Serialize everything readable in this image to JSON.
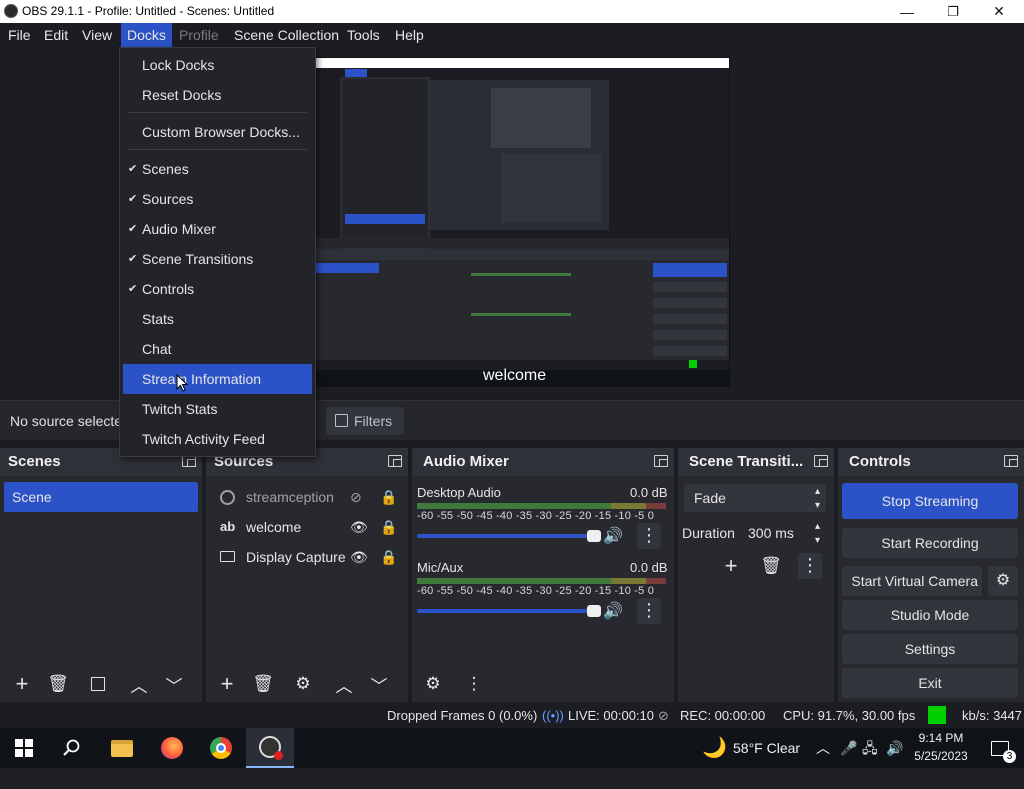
{
  "window": {
    "title": "OBS 29.1.1 - Profile: Untitled - Scenes: Untitled",
    "minimize": "—",
    "maximize": "❐",
    "close": "✕"
  },
  "menubar": {
    "items": [
      "File",
      "Edit",
      "View",
      "Docks",
      "Profile",
      "Scene Collection",
      "Tools",
      "Help"
    ]
  },
  "docks_menu": {
    "items": [
      {
        "label": "Lock Docks"
      },
      {
        "label": "Reset Docks"
      },
      {
        "label": "Custom Browser Docks..."
      },
      {
        "label": "Scenes",
        "checked": true
      },
      {
        "label": "Sources",
        "checked": true
      },
      {
        "label": "Audio Mixer",
        "checked": true
      },
      {
        "label": "Scene Transitions",
        "checked": true
      },
      {
        "label": "Controls",
        "checked": true
      },
      {
        "label": "Stats"
      },
      {
        "label": "Chat"
      },
      {
        "label": "Stream Information",
        "highlighted": true
      },
      {
        "label": "Twitch Stats"
      },
      {
        "label": "Twitch Activity Feed"
      }
    ]
  },
  "context_bar": {
    "no_source": "No source selected",
    "filters": "Filters"
  },
  "scenes": {
    "title": "Scenes",
    "items": [
      "Scene"
    ]
  },
  "sources": {
    "title": "Sources",
    "items": [
      "streamception",
      "welcome",
      "Display Capture"
    ]
  },
  "audio_mixer": {
    "title": "Audio Mixer",
    "channels": [
      {
        "name": "Desktop Audio",
        "level": "0.0 dB"
      },
      {
        "name": "Mic/Aux",
        "level": "0.0 dB"
      }
    ],
    "ticks": "-60 -55 -50 -45 -40 -35 -30 -25 -20 -15 -10 -5 0"
  },
  "transitions": {
    "title": "Scene Transiti...",
    "selected": "Fade",
    "duration_label": "Duration",
    "duration_value": "300 ms"
  },
  "controls": {
    "title": "Controls",
    "stop_streaming": "Stop Streaming",
    "start_recording": "Start Recording",
    "start_virtual_camera": "Start Virtual Camera",
    "studio_mode": "Studio Mode",
    "settings": "Settings",
    "exit": "Exit"
  },
  "status": {
    "dropped_frames": "Dropped Frames 0 (0.0%)",
    "live": "LIVE: 00:00:10",
    "rec": "REC: 00:00:00",
    "cpu": "CPU: 91.7%, 30.00 fps",
    "kbs": "kb/s: 3447"
  },
  "preview": {
    "overlay_text": "welcome"
  },
  "taskbar": {
    "weather": "58°F  Clear",
    "time": "9:14 PM",
    "date": "5/25/2023",
    "notifications": "3"
  },
  "colors": {
    "accent": "#2b52c6",
    "panel": "#27292f",
    "background": "#1c1d22",
    "live_indicator": "#00d000"
  }
}
